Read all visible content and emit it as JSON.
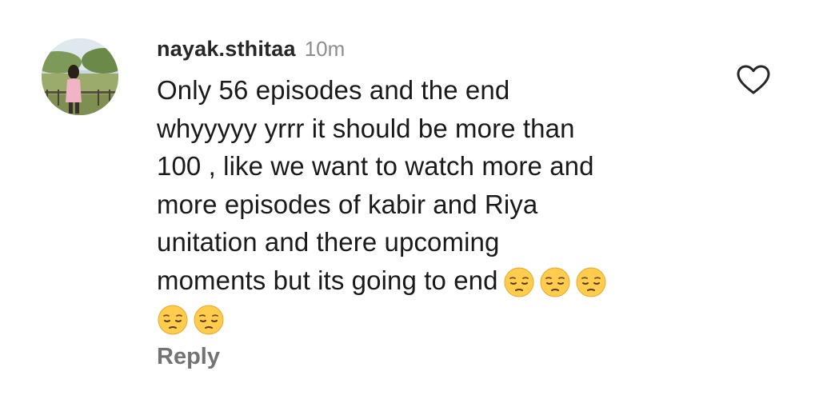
{
  "comment": {
    "username": "nayak.sthitaa",
    "timestamp": "10m",
    "lines": [
      "Only 56 episodes and the end",
      "whyyyyy yrrr it should be more than",
      "100 , like we want to watch more and",
      "more episodes of kabir and Riya",
      "unitation and there upcoming",
      "moments but its going to end"
    ],
    "emoji_line_6": [
      "😔",
      "😔",
      "😔"
    ],
    "emoji_line_7": [
      "😔",
      "😔"
    ],
    "reply_label": "Reply",
    "avatar_icon": "profile-photo",
    "like_icon": "heart-outline-icon",
    "emoji_icon": "pensive-face-emoji"
  },
  "colors": {
    "username": "#262626",
    "timestamp": "#8e8e8e",
    "reply": "#737373",
    "emoji": "#FFCC4D"
  }
}
